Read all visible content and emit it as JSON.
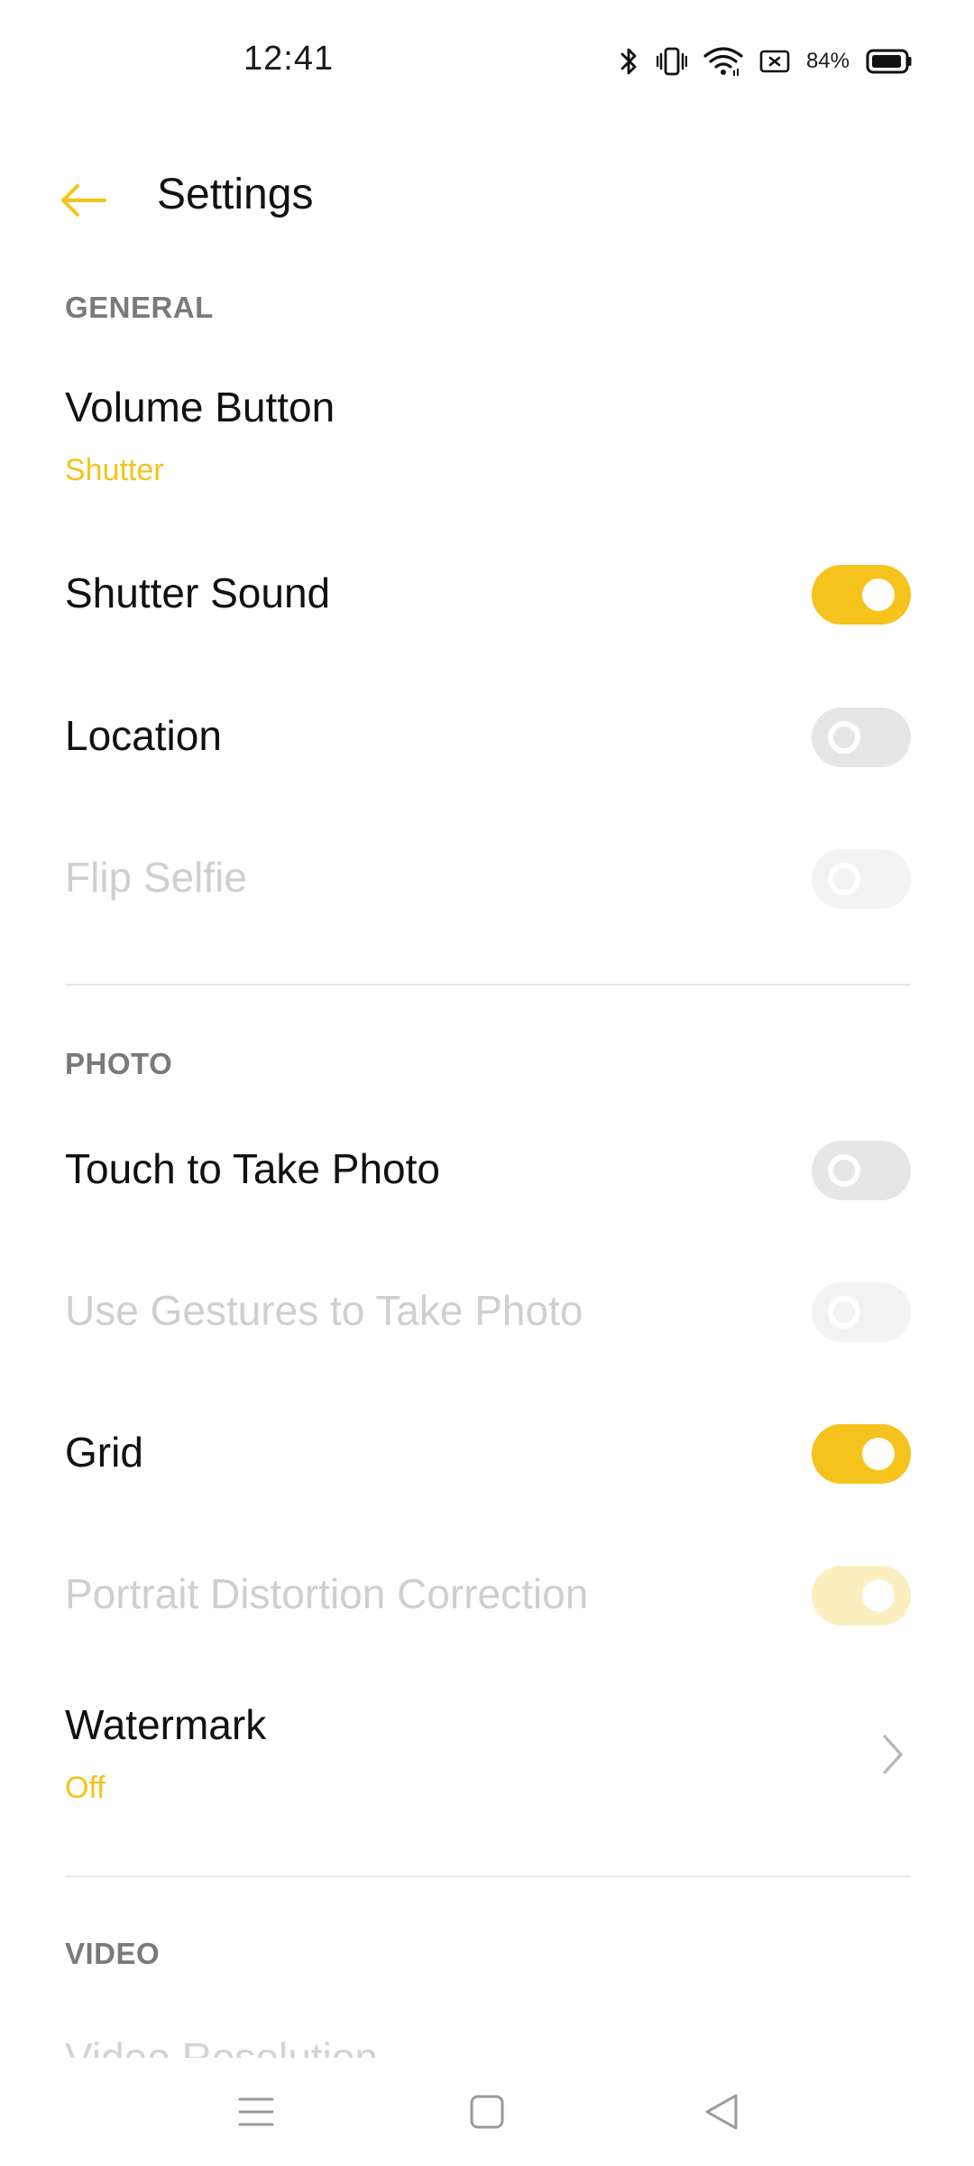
{
  "status_bar": {
    "time": "12:41",
    "battery_percent": "84%",
    "icons": [
      "bluetooth-icon",
      "vibrate-icon",
      "wifi-icon",
      "sim-icon",
      "battery-icon"
    ]
  },
  "header": {
    "title": "Settings",
    "back_icon": "back-arrow-icon"
  },
  "sections": {
    "general": {
      "title": "GENERAL",
      "volume_button": {
        "label": "Volume Button",
        "value": "Shutter"
      },
      "shutter_sound": {
        "label": "Shutter Sound",
        "state": "on"
      },
      "location": {
        "label": "Location",
        "state": "off"
      },
      "flip_selfie": {
        "label": "Flip Selfie",
        "state": "off",
        "disabled": true
      }
    },
    "photo": {
      "title": "PHOTO",
      "touch_to_take_photo": {
        "label": "Touch to Take Photo",
        "state": "off"
      },
      "use_gestures": {
        "label": "Use Gestures to Take Photo",
        "state": "off",
        "disabled": true
      },
      "grid": {
        "label": "Grid",
        "state": "on"
      },
      "portrait_distortion": {
        "label": "Portrait Distortion Correction",
        "state": "on",
        "disabled": true
      },
      "watermark": {
        "label": "Watermark",
        "value": "Off"
      }
    },
    "video": {
      "title": "VIDEO",
      "video_resolution": {
        "label": "Video Resolution"
      }
    }
  },
  "nav_bar": {
    "items": [
      "menu-icon",
      "home-icon",
      "back-icon"
    ]
  },
  "colors": {
    "accent": "#f6c21c",
    "accent_text": "#f2c51a",
    "section_header": "#7a7a7a",
    "disabled_text": "#cfcfcf"
  }
}
